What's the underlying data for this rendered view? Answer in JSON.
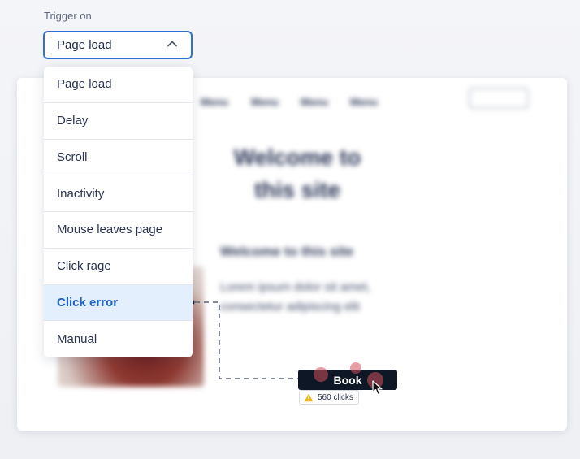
{
  "trigger": {
    "label": "Trigger on",
    "selected_value": "Page load",
    "options": [
      {
        "label": "Page load"
      },
      {
        "label": "Delay"
      },
      {
        "label": "Scroll"
      },
      {
        "label": "Inactivity"
      },
      {
        "label": "Mouse leaves page"
      },
      {
        "label": "Click rage"
      },
      {
        "label": "Click error",
        "highlighted": true
      },
      {
        "label": "Manual"
      }
    ]
  },
  "preview": {
    "nav_links": [
      "Menu",
      "Menu",
      "Menu",
      "Menu"
    ],
    "hero_title": "Welcome to this site",
    "hero_subtitle": "Welcome to this site",
    "hero_body": "Lorem ipsum dolor sit amet, consectetur adipiscing elit"
  },
  "target": {
    "button_label": "Book",
    "clicks_text": "560 clicks"
  },
  "colors": {
    "accent": "#2f6fd6",
    "selected_text": "#1f62c9",
    "selected_bg": "#e4effd",
    "button_bg": "#0d1726",
    "warning": "#f2b705",
    "click_marker": "#d2505a"
  },
  "icons": {
    "select_chevron": "chevron-up-icon",
    "badge": "warning-icon",
    "pointer": "cursor-icon"
  }
}
